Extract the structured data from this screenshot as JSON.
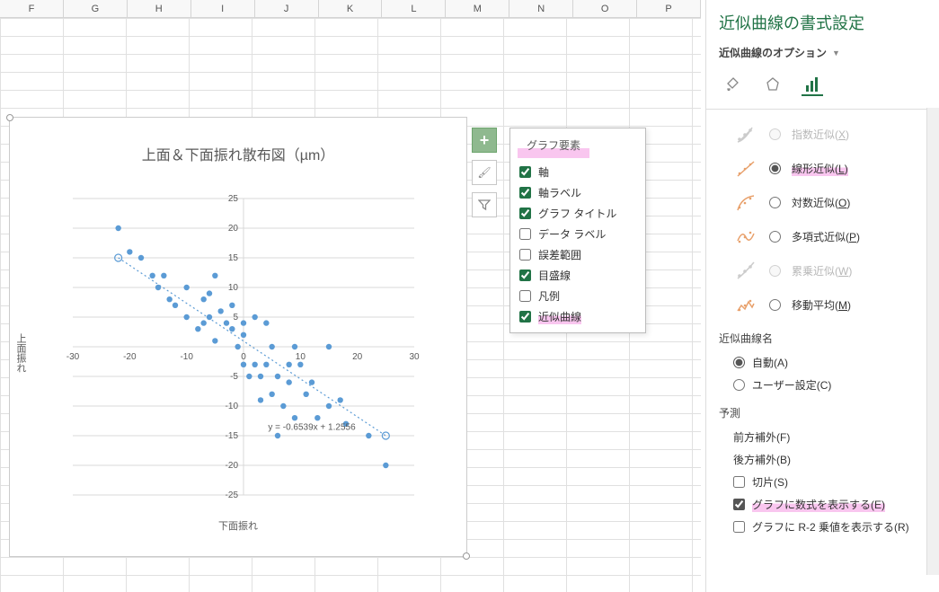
{
  "columns": [
    "F",
    "G",
    "H",
    "I",
    "J",
    "K",
    "L",
    "M",
    "N",
    "O",
    "P"
  ],
  "chart_data": {
    "type": "scatter",
    "title": "上面＆下面振れ散布図（µm）",
    "xlabel": "下面振れ",
    "ylabel": "上面振れ",
    "xlim": [
      -30,
      30
    ],
    "ylim": [
      -25,
      25
    ],
    "xticks": [
      -30,
      -20,
      -10,
      0,
      10,
      20,
      30
    ],
    "yticks": [
      -25,
      -20,
      -15,
      -10,
      -5,
      0,
      5,
      10,
      15,
      20,
      25
    ],
    "equation": "y = -0.6539x + 1.2556",
    "trend_endpoints": [
      [
        -22,
        15
      ],
      [
        25,
        -15
      ]
    ],
    "data": [
      [
        -22,
        20
      ],
      [
        -20,
        16
      ],
      [
        -18,
        15
      ],
      [
        -16,
        12
      ],
      [
        -15,
        10
      ],
      [
        -14,
        12
      ],
      [
        -13,
        8
      ],
      [
        -12,
        7
      ],
      [
        -10,
        10
      ],
      [
        -10,
        5
      ],
      [
        -8,
        3
      ],
      [
        -7,
        4
      ],
      [
        -7,
        8
      ],
      [
        -6,
        9
      ],
      [
        -6,
        5
      ],
      [
        -5,
        12
      ],
      [
        -5,
        1
      ],
      [
        -4,
        6
      ],
      [
        -3,
        4
      ],
      [
        -2,
        3
      ],
      [
        -2,
        7
      ],
      [
        -1,
        0
      ],
      [
        0,
        4
      ],
      [
        0,
        2
      ],
      [
        0,
        -3
      ],
      [
        1,
        -5
      ],
      [
        2,
        -3
      ],
      [
        2,
        5
      ],
      [
        3,
        -5
      ],
      [
        3,
        -9
      ],
      [
        4,
        -3
      ],
      [
        4,
        4
      ],
      [
        5,
        0
      ],
      [
        5,
        -8
      ],
      [
        6,
        -5
      ],
      [
        6,
        -15
      ],
      [
        7,
        -10
      ],
      [
        8,
        -6
      ],
      [
        8,
        -3
      ],
      [
        9,
        -12
      ],
      [
        9,
        0
      ],
      [
        10,
        -3
      ],
      [
        11,
        -8
      ],
      [
        12,
        -6
      ],
      [
        13,
        -12
      ],
      [
        15,
        -10
      ],
      [
        15,
        0
      ],
      [
        17,
        -9
      ],
      [
        18,
        -13
      ],
      [
        22,
        -15
      ],
      [
        25,
        -20
      ]
    ]
  },
  "toolbar": {
    "plus": "+",
    "brush": "🖌",
    "filter": "▼"
  },
  "popup": {
    "title": "グラフ要素",
    "items": [
      {
        "label": "軸",
        "checked": true
      },
      {
        "label": "軸ラベル",
        "checked": true
      },
      {
        "label": "グラフ タイトル",
        "checked": true
      },
      {
        "label": "データ ラベル",
        "checked": false
      },
      {
        "label": "誤差範囲",
        "checked": false
      },
      {
        "label": "目盛線",
        "checked": true
      },
      {
        "label": "凡例",
        "checked": false
      },
      {
        "label": "近似曲線",
        "checked": true,
        "highlight": true
      }
    ]
  },
  "pane": {
    "title": "近似曲線の書式設定",
    "subtitle": "近似曲線のオプション",
    "trend_types": [
      {
        "label": "指数近似(X)",
        "key": "X",
        "enabled": false
      },
      {
        "label": "線形近似(L)",
        "key": "L",
        "enabled": true,
        "selected": true,
        "highlight": true
      },
      {
        "label": "対数近似(O)",
        "key": "O",
        "enabled": true
      },
      {
        "label": "多項式近似(P)",
        "key": "P",
        "enabled": true
      },
      {
        "label": "累乗近似(W)",
        "key": "W",
        "enabled": false
      },
      {
        "label": "移動平均(M)",
        "key": "M",
        "enabled": true
      }
    ],
    "name_section": "近似曲線名",
    "name_auto": "自動(A)",
    "name_custom": "ユーザー設定(C)",
    "forecast_section": "予測",
    "forecast_fwd": "前方補外(F)",
    "forecast_bwd": "後方補外(B)",
    "intercept": "切片(S)",
    "show_eq": "グラフに数式を表示する(E)",
    "show_r2": "グラフに R-2 乗値を表示する(R)"
  }
}
